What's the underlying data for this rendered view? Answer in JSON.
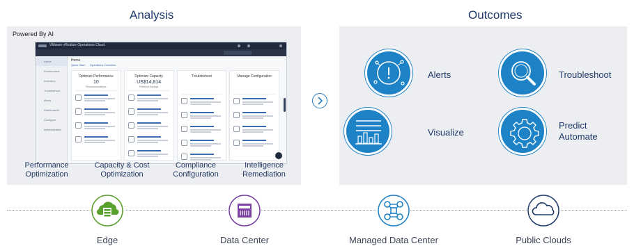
{
  "sections": {
    "analysis_title": "Analysis",
    "outcomes_title": "Outcomes"
  },
  "analysis": {
    "powered_by": "Powered By AI",
    "features": [
      {
        "line1": "Performance",
        "line2": "Optimization"
      },
      {
        "line1": "Capacity & Cost",
        "line2": "Optimization"
      },
      {
        "line1": "Compliance",
        "line2": "Configuration"
      },
      {
        "line1": "Intelligence",
        "line2": "Remediation"
      }
    ],
    "screenshot": {
      "app_title": "VMware vRealize Operations Cloud",
      "page": "Home",
      "tabs": [
        "Quick Start",
        "Operations Overview"
      ],
      "sidebar": [
        "Home",
        "Environment",
        "Inventory",
        "Troubleshoot",
        "Alerts",
        "Dashboards",
        "Configure",
        "Administration"
      ],
      "columns": [
        {
          "title": "Optimize Performance",
          "value": "10",
          "sub": "Recommendations"
        },
        {
          "title": "Optimize Capacity",
          "value": "US$14,814",
          "sub": "Potential Savings"
        },
        {
          "title": "Troubleshoot",
          "value": "",
          "sub": ""
        },
        {
          "title": "Manage Configuration",
          "value": "",
          "sub": ""
        }
      ]
    }
  },
  "outcomes": {
    "items": [
      {
        "label": "Alerts",
        "icon": "alert-icon"
      },
      {
        "label": "Troubleshoot",
        "icon": "magnifier-icon"
      },
      {
        "label": "Visualize",
        "icon": "bar-chart-icon"
      },
      {
        "label_line1": "Predict",
        "label_line2": "Automate",
        "icon": "gear-icon"
      }
    ]
  },
  "environments": [
    {
      "label": "Edge",
      "icon": "edge-cloud-icon",
      "color": "#5aa02c"
    },
    {
      "label": "Data Center",
      "icon": "data-center-icon",
      "color": "#7a3fa0"
    },
    {
      "label": "Managed Data Center",
      "icon": "managed-data-center-icon",
      "color": "#1e82c6"
    },
    {
      "label": "Public Clouds",
      "icon": "public-cloud-icon",
      "color": "#1f3a6b"
    }
  ],
  "colors": {
    "accent_blue": "#1e82c6",
    "title_navy": "#1f3a6b",
    "panel_bg": "#eceef1"
  }
}
